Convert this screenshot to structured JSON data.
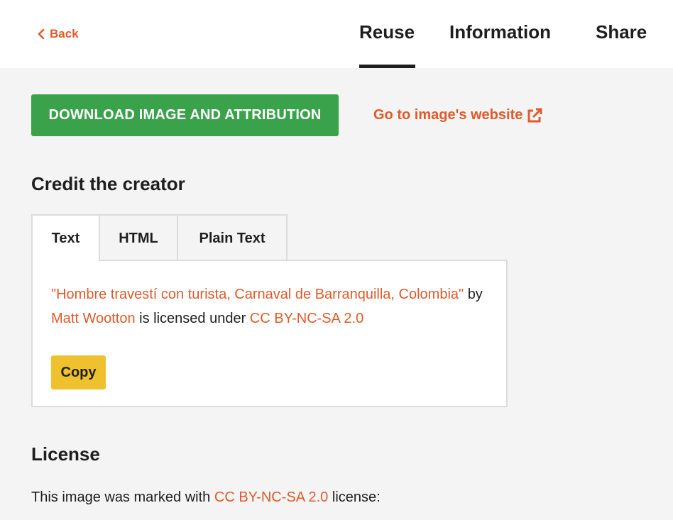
{
  "header": {
    "back_label": "Back",
    "tabs": [
      {
        "label": "Reuse",
        "active": true
      },
      {
        "label": "Information",
        "active": false
      },
      {
        "label": "Share",
        "active": false
      }
    ]
  },
  "actions": {
    "download_label": "DOWNLOAD IMAGE AND ATTRIBUTION",
    "site_link_label": "Go to image's website"
  },
  "credit": {
    "heading": "Credit the creator",
    "tabs": [
      {
        "label": "Text",
        "active": true
      },
      {
        "label": "HTML",
        "active": false
      },
      {
        "label": "Plain Text",
        "active": false
      }
    ],
    "attribution": {
      "title": "\"Hombre travestí con turista, Carnaval de Barranquilla, Colombia\"",
      "by": "by",
      "creator": "Matt Wootton",
      "licensed_under": "is licensed under",
      "license": "CC BY-NC-SA 2.0"
    },
    "copy_label": "Copy"
  },
  "license": {
    "heading": "License",
    "prefix": "This image was marked with",
    "license": "CC BY-NC-SA 2.0",
    "suffix": "license:"
  },
  "colors": {
    "accent": "#e05a2c",
    "download_button": "#3aa24a",
    "copy_button": "#efc12e",
    "page_background": "#f4f4f4"
  },
  "icons": {
    "back": "chevron-left-icon",
    "external": "external-link-icon"
  }
}
